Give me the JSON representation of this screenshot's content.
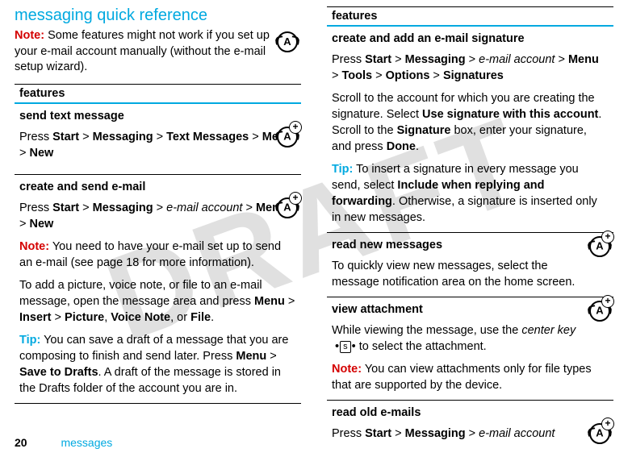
{
  "watermark": "DRAFT",
  "heading": "messaging quick reference",
  "intro_note_prefix": "Note:",
  "intro_text": " Some features might not work if you set up your e-mail account manually (without the e-mail setup wizard).",
  "features_header": "features",
  "left_rows": {
    "send_text": {
      "title": "send text message",
      "line1_pre": "Press ",
      "c1": "Start",
      "g1": " > ",
      "c2": "Messaging",
      "g2": " > ",
      "c3": "Text Messages",
      "g3": " > ",
      "c4": "Menu",
      "g4": " > ",
      "c5": "New"
    },
    "create_send": {
      "title": "create and send e-mail",
      "l1_pre": "Press ",
      "c1": "Start",
      "g1": " > ",
      "c2": "Messaging",
      "g2": " > ",
      "i1": "e-mail account",
      "g3": " > ",
      "c3": "Menu",
      "g4": " > ",
      "c4": "New",
      "note_prefix": "Note:",
      "note_text": " You need to have your e-mail set up to send an e-mail (see page 18 for more information).",
      "p2a": "To add a picture, voice note, or file to an e-mail message, open the message area and press ",
      "p2_c1": "Menu",
      "p2_g1": " > ",
      "p2_c2": "Insert",
      "p2_g2": " > ",
      "p2_c3": "Picture",
      "p2_comma1": ", ",
      "p2_c4": "Voice Note",
      "p2_comma2": ", or ",
      "p2_c5": "File",
      "p2_end": ".",
      "tip_prefix": "Tip:",
      "tip_a": " You can save a draft of a message that you are composing to finish and send later. Press ",
      "tip_c1": "Menu",
      "tip_g1": " > ",
      "tip_c2": "Save to Drafts",
      "tip_b": ". A draft of the message is stored in the Drafts folder of the account you are in."
    }
  },
  "right_rows": {
    "sig": {
      "title": "create and add an e-mail signature",
      "l1_pre": "Press ",
      "c1": "Start",
      "g1": " > ",
      "c2": "Messaging",
      "g2": " > ",
      "i1": "e-mail account ",
      "g3": " > ",
      "c3": "Menu",
      "g4": " > ",
      "c4": "Tools",
      "g5": " > ",
      "c5": "Options",
      "g6": " > ",
      "c6": "Signatures",
      "p2a": "Scroll to the account for which you are creating the signature. Select ",
      "p2_c1": "Use signature with this account",
      "p2b": ". Scroll to the ",
      "p2_c2": "Signature",
      "p2c": " box, enter your signature, and press ",
      "p2_c3": "Done",
      "p2_end": ".",
      "tip_prefix": "Tip:",
      "tip_a": " To insert a signature in every message you send, select ",
      "tip_c1": "Include when replying and forwarding",
      "tip_b": ". Otherwise, a signature is inserted only in new messages."
    },
    "readnew": {
      "title": "read new messages",
      "text": "To quickly view new messages, select the message notification area on the home screen."
    },
    "viewatt": {
      "title": "view attachment",
      "p1a": "While viewing the message, use the ",
      "i1": "center key",
      "key": "s",
      "p1b": " to select the attachment.",
      "note_prefix": "Note:",
      "note_text": " You can view attachments only for file types that are supported by the device."
    },
    "readold": {
      "title": "read old e-mails",
      "l1_pre": "Press ",
      "c1": "Start",
      "g1": " > ",
      "c2": "Messaging",
      "g2": " > ",
      "i1": "e-mail account"
    }
  },
  "footer": {
    "page": "20",
    "section": "messages"
  }
}
